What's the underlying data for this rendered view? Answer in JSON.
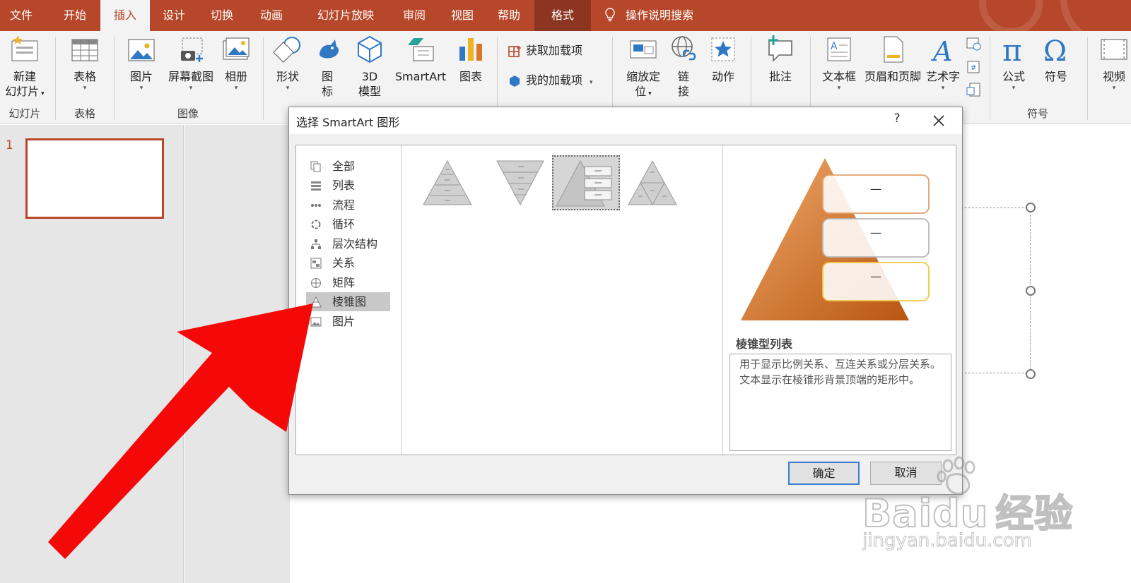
{
  "tabs": [
    {
      "label": "文件"
    },
    {
      "label": "开始"
    },
    {
      "label": "插入"
    },
    {
      "label": "设计"
    },
    {
      "label": "切换"
    },
    {
      "label": "动画"
    },
    {
      "label": "幻灯片放映"
    },
    {
      "label": "审阅"
    },
    {
      "label": "视图"
    },
    {
      "label": "帮助"
    },
    {
      "label": "格式"
    }
  ],
  "active_tab": "插入",
  "tell_me": "操作说明搜索",
  "ribbon": {
    "new_slide_l1": "新建",
    "new_slide_l2": "幻灯片",
    "table": "表格",
    "picture": "图片",
    "screenshot": "屏幕截图",
    "album": "相册",
    "shapes": "形状",
    "icons_l1": "图",
    "icons_l2": "标",
    "model3d_l1": "3D",
    "model3d_l2": "模型",
    "smartart": "SmartArt",
    "chart": "图表",
    "get_addins": "获取加载项",
    "my_addins": "我的加载项",
    "zoom_l1": "缩放定",
    "zoom_l2": "位",
    "link_l1": "链",
    "link_l2": "接",
    "action": "动作",
    "comment": "批注",
    "textbox": "文本框",
    "header_footer": "页眉和页脚",
    "wordart": "艺术字",
    "equation": "公式",
    "symbol": "符号",
    "video": "视频",
    "groups": {
      "slides": "幻灯片",
      "tables": "表格",
      "images": "图像",
      "symbols": "符号"
    }
  },
  "slide_panel": {
    "slide_number": "1"
  },
  "dialog": {
    "title": "选择 SmartArt 图形",
    "help": "?",
    "categories": [
      {
        "label": "全部"
      },
      {
        "label": "列表"
      },
      {
        "label": "流程"
      },
      {
        "label": "循环"
      },
      {
        "label": "层次结构"
      },
      {
        "label": "关系"
      },
      {
        "label": "矩阵"
      },
      {
        "label": "棱锥图"
      },
      {
        "label": "图片"
      }
    ],
    "selected_category": "棱锥图",
    "selected_layout_index": 2,
    "preview_title": "棱锥型列表",
    "preview_desc": "用于显示比例关系、互连关系或分层关系。文本显示在棱锥形背景顶端的矩形中。",
    "preview_item_text": "—",
    "ok": "确定",
    "cancel": "取消"
  },
  "watermark": {
    "brand": "Baidu",
    "cn": "经验",
    "url": "jingyan.baidu.com"
  },
  "colors": {
    "accent": "#b7472a",
    "annotation_arrow": "#f40808",
    "selection_blue": "#3c7fd0",
    "pyramid_orange": "#d9772a"
  }
}
